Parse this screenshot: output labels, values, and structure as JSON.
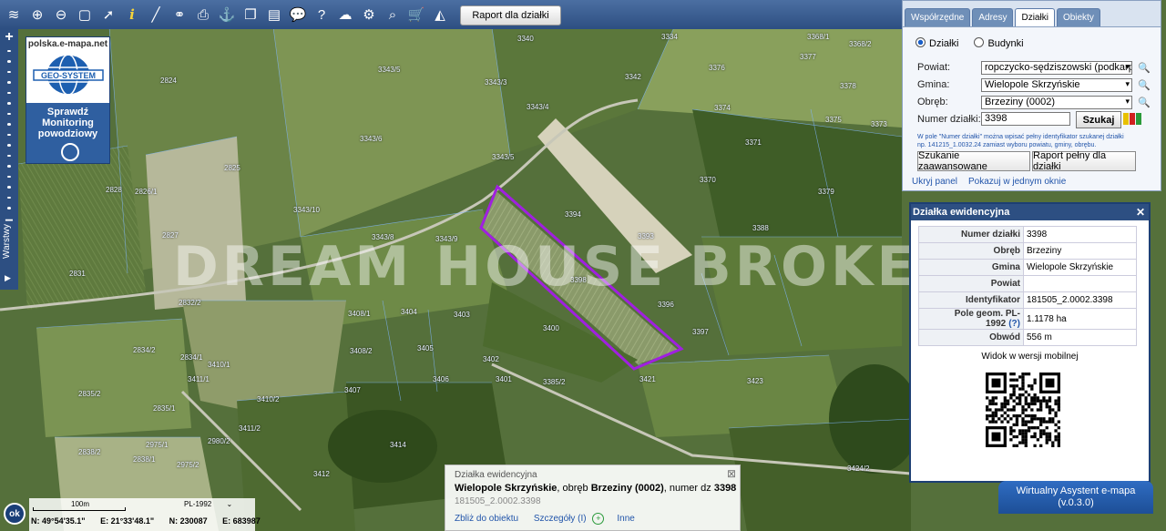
{
  "toolbar": {
    "report_button": "Raport dla działki",
    "icons": [
      "layers-icon",
      "zoom-in-icon",
      "zoom-out-icon",
      "full-extent-icon",
      "pointer-icon",
      "info-icon",
      "measure-icon",
      "link-icon",
      "print-icon",
      "coordinates-icon",
      "copy-icon",
      "layout-icon",
      "comment-icon",
      "help-icon",
      "upload-icon",
      "settings-icon",
      "search-map-icon",
      "cart-icon",
      "terrain-icon"
    ]
  },
  "left_strip": {
    "zoom_in": "+",
    "zoom_out": "−",
    "layers_label": "Warstwy"
  },
  "geo_logo": {
    "site": "polska.e-mapa.net",
    "brand": "GEO-SYSTEM",
    "flood_line1": "Sprawdź",
    "flood_line2": "Monitoring",
    "flood_line3": "powodziowy"
  },
  "map": {
    "watermark": "DREAM HOUSE BROKERS",
    "parcel_labels": [
      "3340",
      "3343/5",
      "3343/3",
      "3343/4",
      "3343/6",
      "3343/5",
      "3343/10",
      "3343/8",
      "3343/9",
      "3342",
      "3334",
      "3376",
      "3368/1",
      "3368/2",
      "3377",
      "3378",
      "3374",
      "3375",
      "3373",
      "3371",
      "3370",
      "3379",
      "3388",
      "3393",
      "3394",
      "3396",
      "3397",
      "3398",
      "3400",
      "3402",
      "3403",
      "3404",
      "3405",
      "3406",
      "3407",
      "3408/1",
      "3408/2",
      "3401",
      "3385/2",
      "3421",
      "3423",
      "3424/6",
      "3424/2",
      "3410/2",
      "3410/1",
      "3411/2",
      "3411/1",
      "3414",
      "3412",
      "2824",
      "2825",
      "2826/1",
      "2827",
      "2828",
      "2831",
      "2832/2",
      "2834/2",
      "2834/1",
      "2835/2",
      "2835/1",
      "2838/2",
      "2838/1",
      "2975/1",
      "2975/2",
      "2980/2"
    ]
  },
  "scale": {
    "label": "100m",
    "crs": "PL-1992",
    "lat": "N: 49°54'35.1\"",
    "lon": "E: 21°33'48.1\"",
    "n": "N: 230087",
    "e": "E: 683987"
  },
  "ok_label": "ok",
  "search_panel": {
    "tabs": [
      "Współrzędne",
      "Adresy",
      "Działki",
      "Obiekty"
    ],
    "active_tab": "Działki",
    "radio_parcels": "Działki",
    "radio_buildings": "Budynki",
    "powiat_label": "Powiat:",
    "powiat_value": "ropczycko-sędziszowski (podkarp",
    "gmina_label": "Gmina:",
    "gmina_value": "Wielopole Skrzyńskie",
    "obreb_label": "Obręb:",
    "obreb_value": "Brzeziny (0002)",
    "number_label": "Numer działki:",
    "number_value": "3398",
    "search_button": "Szukaj",
    "hint_1": "W pole \"Numer działki\" można wpisać pełny identyfikator szukanej działki",
    "hint_2": "np. 141215_1.0032.24 zamiast wyboru powiatu, gminy, obrębu.",
    "advanced_button": "Szukanie zaawansowane",
    "full_report_button": "Raport pełny dla działki",
    "hide_panel": "Ukryj panel",
    "show_in_one": "Pokazuj w jednym oknie"
  },
  "parcel_panel": {
    "title": "Działka ewidencyjna",
    "rows": [
      {
        "k": "Numer działki",
        "v": "3398"
      },
      {
        "k": "Obręb",
        "v": "Brzeziny"
      },
      {
        "k": "Gmina",
        "v": "Wielopole Skrzyńskie"
      },
      {
        "k": "Powiat",
        "v": ""
      },
      {
        "k": "Identyfikator",
        "v": "181505_2.0002.3398"
      },
      {
        "k": "Pole geom. PL-1992",
        "v": "1.1178 ha"
      },
      {
        "k": "Obwód",
        "v": "556 m"
      }
    ],
    "help_mark": "(?)",
    "mobile_label": "Widok w wersji mobilnej"
  },
  "assistant": {
    "line1": "Wirtualny Asystent e-mapa",
    "line2": "(v.0.3.0)"
  },
  "info_box": {
    "title": "Działka ewidencyjna",
    "gmina": "Wielopole Skrzyńskie",
    "obreb_word": ", obręb ",
    "obreb": "Brzeziny (0002)",
    "numer_word": ", numer dz ",
    "numer": "3398",
    "id": "181505_2.0002.3398",
    "zoom_link": "Zbliż do obiektu",
    "details_link": "Szczegóły (I)",
    "other_link": "Inne"
  },
  "colors": {
    "toolbar": "#2d4f82",
    "parcel_outline": "#a020e0",
    "qr": "#000000"
  }
}
